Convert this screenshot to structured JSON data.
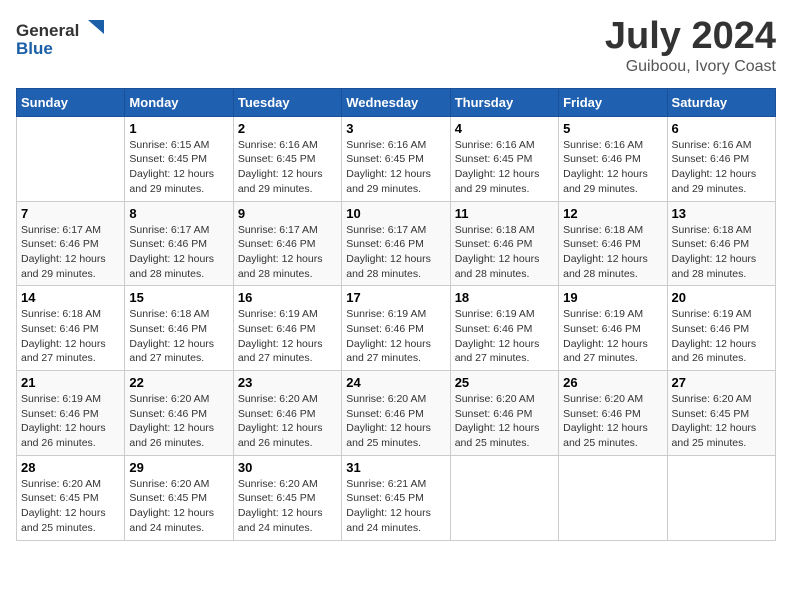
{
  "header": {
    "logo_general": "General",
    "logo_blue": "Blue",
    "month_year": "July 2024",
    "location": "Guiboou, Ivory Coast"
  },
  "days_of_week": [
    "Sunday",
    "Monday",
    "Tuesday",
    "Wednesday",
    "Thursday",
    "Friday",
    "Saturday"
  ],
  "weeks": [
    [
      {
        "day": "",
        "info": ""
      },
      {
        "day": "1",
        "info": "Sunrise: 6:15 AM\nSunset: 6:45 PM\nDaylight: 12 hours\nand 29 minutes."
      },
      {
        "day": "2",
        "info": "Sunrise: 6:16 AM\nSunset: 6:45 PM\nDaylight: 12 hours\nand 29 minutes."
      },
      {
        "day": "3",
        "info": "Sunrise: 6:16 AM\nSunset: 6:45 PM\nDaylight: 12 hours\nand 29 minutes."
      },
      {
        "day": "4",
        "info": "Sunrise: 6:16 AM\nSunset: 6:45 PM\nDaylight: 12 hours\nand 29 minutes."
      },
      {
        "day": "5",
        "info": "Sunrise: 6:16 AM\nSunset: 6:46 PM\nDaylight: 12 hours\nand 29 minutes."
      },
      {
        "day": "6",
        "info": "Sunrise: 6:16 AM\nSunset: 6:46 PM\nDaylight: 12 hours\nand 29 minutes."
      }
    ],
    [
      {
        "day": "7",
        "info": "Sunrise: 6:17 AM\nSunset: 6:46 PM\nDaylight: 12 hours\nand 29 minutes."
      },
      {
        "day": "8",
        "info": "Sunrise: 6:17 AM\nSunset: 6:46 PM\nDaylight: 12 hours\nand 28 minutes."
      },
      {
        "day": "9",
        "info": "Sunrise: 6:17 AM\nSunset: 6:46 PM\nDaylight: 12 hours\nand 28 minutes."
      },
      {
        "day": "10",
        "info": "Sunrise: 6:17 AM\nSunset: 6:46 PM\nDaylight: 12 hours\nand 28 minutes."
      },
      {
        "day": "11",
        "info": "Sunrise: 6:18 AM\nSunset: 6:46 PM\nDaylight: 12 hours\nand 28 minutes."
      },
      {
        "day": "12",
        "info": "Sunrise: 6:18 AM\nSunset: 6:46 PM\nDaylight: 12 hours\nand 28 minutes."
      },
      {
        "day": "13",
        "info": "Sunrise: 6:18 AM\nSunset: 6:46 PM\nDaylight: 12 hours\nand 28 minutes."
      }
    ],
    [
      {
        "day": "14",
        "info": "Sunrise: 6:18 AM\nSunset: 6:46 PM\nDaylight: 12 hours\nand 27 minutes."
      },
      {
        "day": "15",
        "info": "Sunrise: 6:18 AM\nSunset: 6:46 PM\nDaylight: 12 hours\nand 27 minutes."
      },
      {
        "day": "16",
        "info": "Sunrise: 6:19 AM\nSunset: 6:46 PM\nDaylight: 12 hours\nand 27 minutes."
      },
      {
        "day": "17",
        "info": "Sunrise: 6:19 AM\nSunset: 6:46 PM\nDaylight: 12 hours\nand 27 minutes."
      },
      {
        "day": "18",
        "info": "Sunrise: 6:19 AM\nSunset: 6:46 PM\nDaylight: 12 hours\nand 27 minutes."
      },
      {
        "day": "19",
        "info": "Sunrise: 6:19 AM\nSunset: 6:46 PM\nDaylight: 12 hours\nand 27 minutes."
      },
      {
        "day": "20",
        "info": "Sunrise: 6:19 AM\nSunset: 6:46 PM\nDaylight: 12 hours\nand 26 minutes."
      }
    ],
    [
      {
        "day": "21",
        "info": "Sunrise: 6:19 AM\nSunset: 6:46 PM\nDaylight: 12 hours\nand 26 minutes."
      },
      {
        "day": "22",
        "info": "Sunrise: 6:20 AM\nSunset: 6:46 PM\nDaylight: 12 hours\nand 26 minutes."
      },
      {
        "day": "23",
        "info": "Sunrise: 6:20 AM\nSunset: 6:46 PM\nDaylight: 12 hours\nand 26 minutes."
      },
      {
        "day": "24",
        "info": "Sunrise: 6:20 AM\nSunset: 6:46 PM\nDaylight: 12 hours\nand 25 minutes."
      },
      {
        "day": "25",
        "info": "Sunrise: 6:20 AM\nSunset: 6:46 PM\nDaylight: 12 hours\nand 25 minutes."
      },
      {
        "day": "26",
        "info": "Sunrise: 6:20 AM\nSunset: 6:46 PM\nDaylight: 12 hours\nand 25 minutes."
      },
      {
        "day": "27",
        "info": "Sunrise: 6:20 AM\nSunset: 6:45 PM\nDaylight: 12 hours\nand 25 minutes."
      }
    ],
    [
      {
        "day": "28",
        "info": "Sunrise: 6:20 AM\nSunset: 6:45 PM\nDaylight: 12 hours\nand 25 minutes."
      },
      {
        "day": "29",
        "info": "Sunrise: 6:20 AM\nSunset: 6:45 PM\nDaylight: 12 hours\nand 24 minutes."
      },
      {
        "day": "30",
        "info": "Sunrise: 6:20 AM\nSunset: 6:45 PM\nDaylight: 12 hours\nand 24 minutes."
      },
      {
        "day": "31",
        "info": "Sunrise: 6:21 AM\nSunset: 6:45 PM\nDaylight: 12 hours\nand 24 minutes."
      },
      {
        "day": "",
        "info": ""
      },
      {
        "day": "",
        "info": ""
      },
      {
        "day": "",
        "info": ""
      }
    ]
  ]
}
